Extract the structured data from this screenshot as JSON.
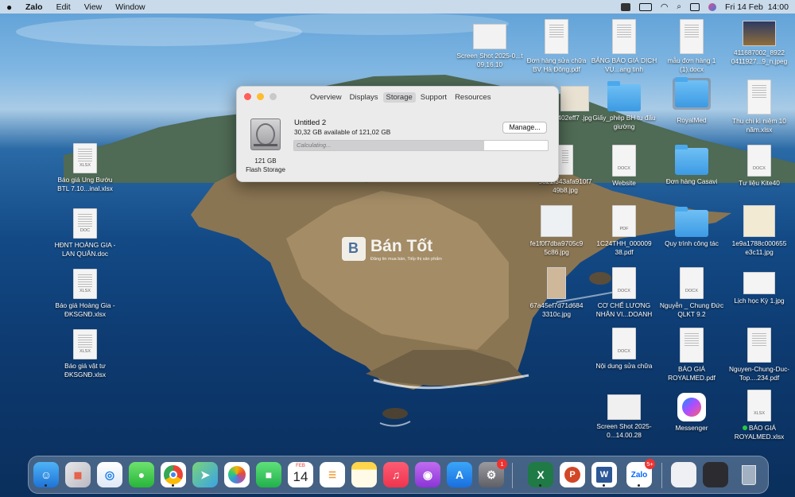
{
  "menubar": {
    "app": "Zalo",
    "items": [
      "Edit",
      "View",
      "Window"
    ],
    "datetime": "Fri 14 Feb  14:00"
  },
  "window": {
    "tabs": [
      "Overview",
      "Displays",
      "Storage",
      "Support",
      "Resources"
    ],
    "active_tab": "Storage",
    "disk_size": "121 GB",
    "disk_type": "Flash Storage",
    "volume_name": "Untitled 2",
    "available": "30,32 GB available of 121,02 GB",
    "manage_label": "Manage...",
    "progress_text": "Calculating...",
    "used_fraction": 0.75
  },
  "watermark": {
    "title": "Bán Tốt",
    "subtitle": "Đăng tin mua bán, Tiếp thị sản phẩm"
  },
  "desktop_left": [
    {
      "label": "Báo giá Ung Bướu BTL 7.10...inal.xlsx",
      "ext": "XLSX"
    },
    {
      "label": "HĐNT HOÀNG GIA - LAN QUÂN.doc",
      "ext": "DOC"
    },
    {
      "label": "Báo giá Hoàng Gia - ĐKSGNĐ.xlsx",
      "ext": "XLSX"
    },
    {
      "label": "Báo giá vật tư ĐKSGNĐ.xlsx",
      "ext": "XLSX"
    }
  ],
  "desktop_right": {
    "screenshot_top": "Screen Shot 2025-0...t 09.16.10",
    "don_hang_pdf": "Đơn hàng sửa chữa BV Hà Đông.pdf",
    "bang_bao_gia": "BẢNG BÁO GIÁ DỊCH VỤ...ang tinh",
    "mau_don_hang": "mẫu đơn hàng 1 (1).docx",
    "jpeg_411": "411687002_8922 0411927...9_n.jpeg",
    "jpg_402": "402eff7 .jpg",
    "giay_phep": "Giấy_phép BH tu đấu giường",
    "royalmed_folder": "RoyalMed",
    "thu_chi": "Thu chi kì niệm 10 năm.xlsx",
    "jpg_9821": "9821f343afa910f7 49b8.jpg",
    "website": "Website",
    "don_hang_casavi": "Đơn hàng Casavi",
    "tu_lieu": "Tư liệu Kite40",
    "jpg_fe1": "fe1f0f7dba9705c9 5c86.jpg",
    "pdf_1c24": "1C24THH_000009 38.pdf",
    "quy_trinh": "Quy trình công tác",
    "jpg_1e9": "1e9a1788c000655 e3c11.jpg",
    "jpg_67a": "67a45ef7d71d684 3310c.jpg",
    "co_che": "CƠ CHẾ LƯƠNG NHÂN VI...DOANH",
    "nguyen_chung": "Nguyễn _ Chung Đức QLKT 9.2",
    "lich_hoc": "Lịch học Kỳ 1.jpg",
    "noi_dung": "Nội dung sửa chữa",
    "bao_gia_pdf": "BÁO GIÁ ROYALMED.pdf",
    "nguyen_chung_pdf": "Nguyen-Chung-Duc-Top....234.pdf",
    "screenshot_bottom": "Screen Shot 2025-0...14.00.28",
    "messenger": "Messenger",
    "bao_gia_xlsx": "BÁO GIÁ ROYALMED.xlsx"
  },
  "dock": {
    "calendar_month": "FEB",
    "calendar_day": "14",
    "settings_badge": "1",
    "zalo_badge": "5+"
  },
  "colors": {
    "accent": "#3d74d6",
    "close": "#fe5f57",
    "minimize": "#febc2e",
    "zoom": "#c9c9cb"
  }
}
